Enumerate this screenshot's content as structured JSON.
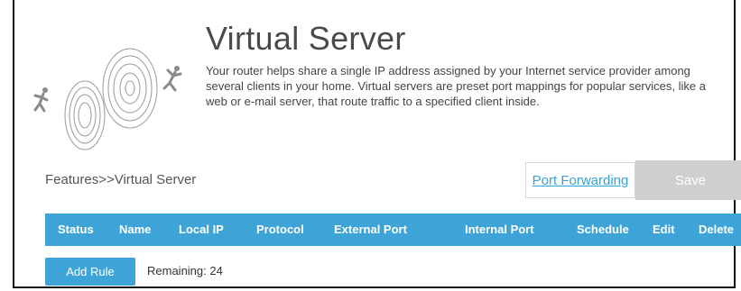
{
  "page": {
    "title": "Virtual Server",
    "description": "Your router helps share a single IP address assigned by your Internet service provider among several clients in your home. Virtual servers are preset port mappings for popular services, like a web or e-mail server, that route traffic to a specified client inside.",
    "breadcrumb": "Features>>Virtual Server"
  },
  "actions": {
    "port_forwarding": "Port Forwarding",
    "save": "Save"
  },
  "table": {
    "columns": [
      "Status",
      "Name",
      "Local IP",
      "Protocol",
      "External Port",
      "Internal Port",
      "Schedule",
      "Edit",
      "Delete"
    ]
  },
  "footer": {
    "add_rule": "Add Rule",
    "remaining": "Remaining: 24"
  },
  "colors": {
    "accent": "#3ea4d8",
    "link": "#39a0d6",
    "disabled_button": "#cfcfcf"
  }
}
